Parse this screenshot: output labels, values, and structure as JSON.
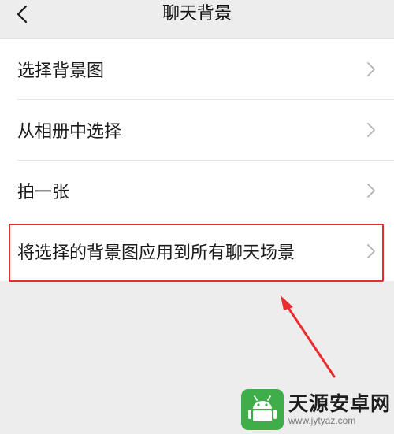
{
  "header": {
    "title": "聊天背景",
    "back_icon": "chevron-left-icon"
  },
  "menu": {
    "items": [
      {
        "label": "选择背景图",
        "icon": "chevron-right-icon"
      },
      {
        "label": "从相册中选择",
        "icon": "chevron-right-icon"
      },
      {
        "label": "拍一张",
        "icon": "chevron-right-icon"
      },
      {
        "label": "将选择的背景图应用到所有聊天场景",
        "icon": "chevron-right-icon",
        "highlighted": true
      }
    ]
  },
  "annotation": {
    "highlight_color": "#e62e2e"
  },
  "watermark": {
    "name": "天源安卓网",
    "url": "www.jytyaz.com",
    "logo_color": "#3fae49"
  },
  "colors": {
    "background": "#ededed",
    "list_background": "#ffffff",
    "text": "#1a1a1a",
    "chevron": "#b2b2b2"
  }
}
